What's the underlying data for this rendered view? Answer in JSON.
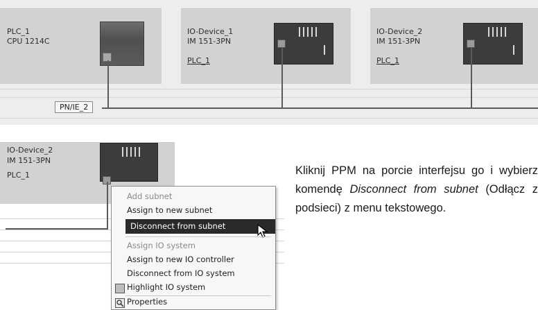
{
  "network_view": {
    "devices": [
      {
        "name": "PLC_1",
        "type": "CPU 1214C"
      },
      {
        "name": "IO-Device_1",
        "type": "IM 151-3PN",
        "controller": "PLC_1"
      },
      {
        "name": "IO-Device_2",
        "type": "IM 151-3PN",
        "controller": "PLC_1"
      }
    ],
    "subnet_label": "PN/IE_2"
  },
  "detail_view": {
    "device": {
      "name": "IO-Device_2",
      "type": "IM 151-3PN",
      "controller": "PLC_1"
    }
  },
  "context_menu": {
    "items": [
      {
        "label": "Add subnet",
        "enabled": false
      },
      {
        "label": "Assign to new subnet",
        "enabled": true
      },
      {
        "label": "Disconnect from subnet",
        "enabled": true,
        "highlighted": true
      },
      {
        "label": "Assign IO system",
        "enabled": false
      },
      {
        "label": "Assign to new IO controller",
        "enabled": true
      },
      {
        "label": "Disconnect from IO system",
        "enabled": true
      },
      {
        "label": "Highlight IO system",
        "enabled": true,
        "icon": "highlight-icon"
      },
      {
        "label": "Properties",
        "enabled": true,
        "icon": "properties-icon"
      }
    ]
  },
  "instruction": {
    "part1": "Kliknij PPM na porcie interfejsu go i wybierz komendę ",
    "italic1": "Disconnect from subnet",
    "part2": " (Odłącz z podsieci) z menu tekstowego."
  }
}
